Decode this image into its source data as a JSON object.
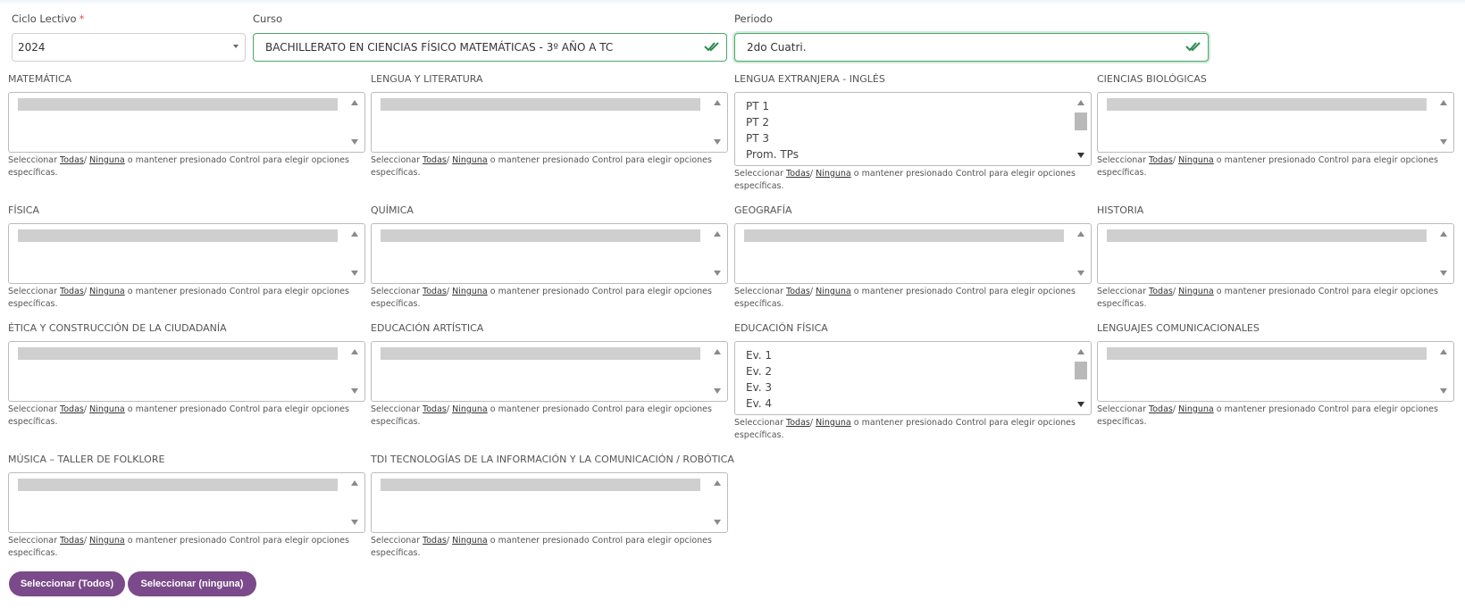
{
  "form": {
    "ciclo": {
      "label": "Ciclo Lectivo",
      "required_mark": "*",
      "value": "2024"
    },
    "curso": {
      "label": "Curso",
      "value": "BACHILLERATO EN CIENCIAS FÍSICO MATEMÁTICAS - 3º AÑO A TC"
    },
    "periodo": {
      "label": "Periodo",
      "value": "2do Cuatri."
    }
  },
  "help": {
    "prefix": "Seleccionar",
    "todas": "Todas",
    "sep": "/",
    "ninguna": "Ninguna",
    "line1_rest": "o mantener presionado Control para elegir opciones",
    "line2": "específicas."
  },
  "subjects": [
    {
      "title": "MATEMÁTICA",
      "options": []
    },
    {
      "title": "LENGUA Y LITERATURA",
      "options": []
    },
    {
      "title": "LENGUA EXTRANJERA - INGLÉS",
      "options": [
        "PT 1",
        "PT 2",
        "PT 3",
        "Prom. TPs"
      ]
    },
    {
      "title": "CIENCIAS BIOLÓGICAS",
      "options": []
    },
    {
      "title": "FÍSICA",
      "options": []
    },
    {
      "title": "QUÍMICA",
      "options": []
    },
    {
      "title": "GEOGRAFÍA",
      "options": []
    },
    {
      "title": "HISTORIA",
      "options": []
    },
    {
      "title": "ÉTICA Y CONSTRUCCIÓN DE LA CIUDADANÍA",
      "options": []
    },
    {
      "title": "EDUCACIÓN ARTÍSTICA",
      "options": []
    },
    {
      "title": "EDUCACIÓN FÍSICA",
      "options": [
        "Ev. 1",
        "Ev. 2",
        "Ev. 3",
        "Ev. 4"
      ]
    },
    {
      "title": "LENGUAJES COMUNICACIONALES",
      "options": []
    },
    {
      "title": "MÚSICA – TALLER DE FOLKLORE",
      "options": []
    },
    {
      "title": "TDI TECNOLOGÍAS DE LA INFORMACIÓN Y LA COMUNICACIÓN / ROBÓTICA",
      "options": []
    }
  ],
  "buttons": {
    "select_all": "Seleccionar (Todos)",
    "select_none": "Seleccionar (ninguna)"
  },
  "colors": {
    "button": "#7a4a8a",
    "valid": "#4aa86a",
    "required": "#d9534f"
  },
  "icons": {
    "valid": "double-check-icon"
  }
}
